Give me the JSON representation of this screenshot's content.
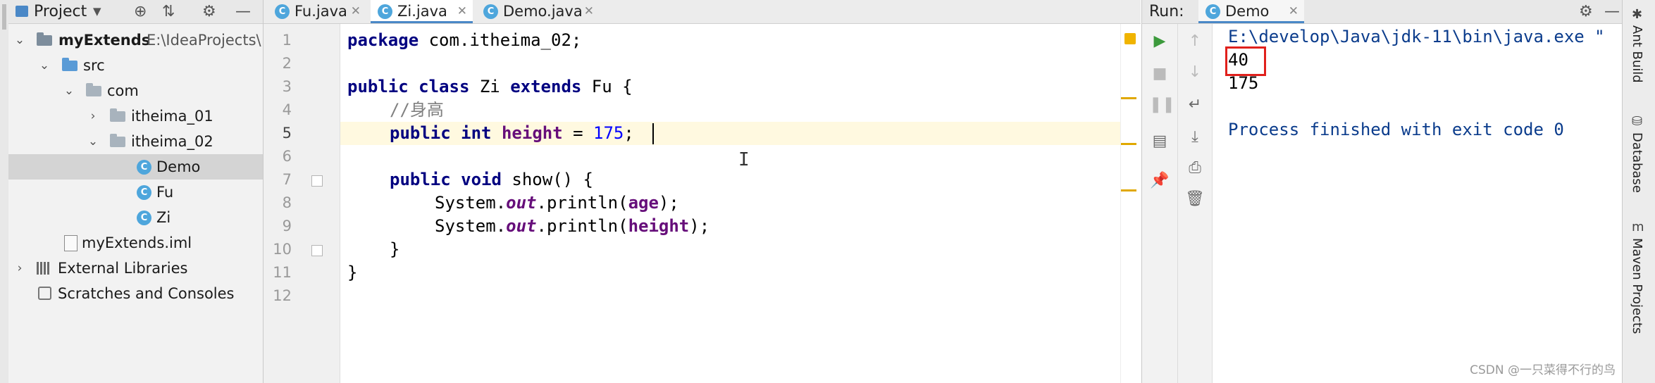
{
  "project": {
    "title": "Project",
    "tree": [
      {
        "label": "myExtends",
        "path": "E:\\IdeaProjects\\"
      },
      {
        "label": "src"
      },
      {
        "label": "com"
      },
      {
        "label": "itheima_01"
      },
      {
        "label": "itheima_02"
      },
      {
        "label": "Demo"
      },
      {
        "label": "Fu"
      },
      {
        "label": "Zi"
      },
      {
        "label": "myExtends.iml"
      },
      {
        "label": "External Libraries"
      },
      {
        "label": "Scratches and Consoles"
      }
    ]
  },
  "editor": {
    "tabs": [
      {
        "label": "Fu.java",
        "icon": "class-icon"
      },
      {
        "label": "Zi.java",
        "icon": "class-icon",
        "active": true
      },
      {
        "label": "Demo.java",
        "icon": "runnable-class-icon"
      }
    ],
    "line_numbers": [
      "1",
      "2",
      "3",
      "4",
      "5",
      "6",
      "7",
      "8",
      "9",
      "10",
      "11",
      "12"
    ],
    "code": {
      "line1": {
        "kw": "package",
        "rest": " com.itheima_02;"
      },
      "line3": {
        "kw1": "public",
        "kw2": "class",
        "name": " Zi ",
        "kw3": "extends",
        "rest": " Fu {"
      },
      "line4": {
        "comment": "//身高"
      },
      "line5": {
        "kw1": "public",
        "kw2": "int",
        "field": "height",
        "eq": " = ",
        "num": "175",
        "end": ";"
      },
      "line7": {
        "kw1": "public",
        "kw2": "void",
        "rest": " show() {"
      },
      "line8": {
        "pre": "System.",
        "stat": "out",
        "mid": ".println(",
        "field": "age",
        "end": ");"
      },
      "line9": {
        "pre": "System.",
        "stat": "out",
        "mid": ".println(",
        "field": "height",
        "end": ");"
      },
      "line10": {
        "text": "}"
      },
      "line11": {
        "text": "}"
      }
    }
  },
  "run": {
    "label": "Run:",
    "tab": "Demo",
    "output": [
      "E:\\develop\\Java\\jdk-11\\bin\\java.exe \"",
      "40",
      "175",
      "",
      "Process finished with exit code 0"
    ]
  },
  "right_tools": [
    "Ant Build",
    "Database",
    "Maven Projects"
  ],
  "watermark": "CSDN @一只菜得不行的鸟",
  "colors": {
    "keyword": "#000080",
    "field": "#660e7a",
    "number": "#0000ff",
    "comment": "#808080",
    "console": "#0b3c8c",
    "highlight": "#e0201c"
  }
}
